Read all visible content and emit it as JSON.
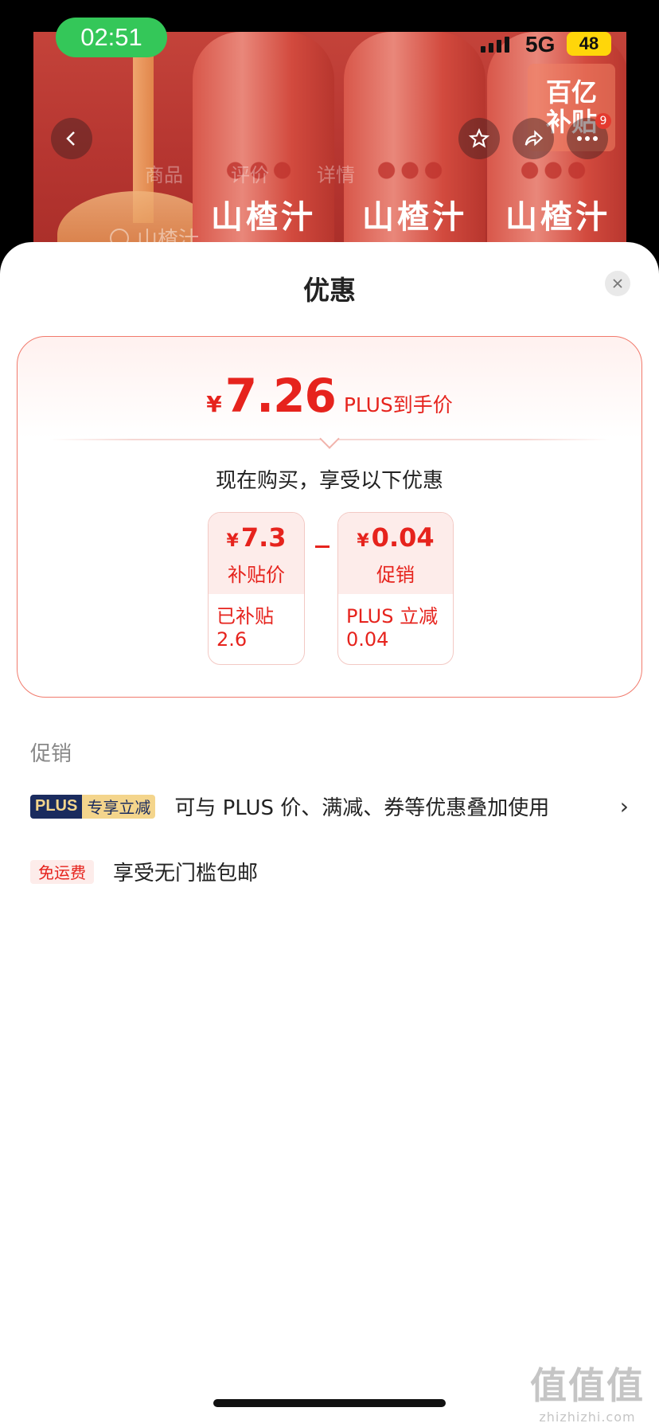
{
  "status_bar": {
    "time": "02:51",
    "network": "5G",
    "battery": "48",
    "colors": {
      "time_pill": "#34c759",
      "battery": "#ffd60a"
    }
  },
  "background_page": {
    "bottle_label": "山楂汁",
    "subsidy_badge": [
      "百亿",
      "补贴"
    ],
    "more_badge_count": "9",
    "tabs": [
      "商品",
      "评价",
      "详情"
    ],
    "search_text": "山楂汁",
    "icons": [
      "back-icon",
      "star-icon",
      "share-icon",
      "more-icon"
    ]
  },
  "sheet": {
    "title": "优惠",
    "close_icon": "close-icon"
  },
  "price_card": {
    "currency": "¥",
    "final_price": "7.26",
    "final_label": "PLUS到手价",
    "intro": "现在购买，享受以下优惠",
    "left": {
      "currency": "¥",
      "amount": "7.3",
      "label": "补贴价",
      "detail": "已补贴\n2.6"
    },
    "right": {
      "currency": "¥",
      "amount": "0.04",
      "label": "促销",
      "detail": "PLUS 立减\n0.04"
    },
    "accent_color": "#e6231d"
  },
  "promotions": {
    "section_label": "促销",
    "items": [
      {
        "tag_main": "PLUS",
        "tag_sub": "专享立减",
        "text": "可与 PLUS 价、满减、券等优惠叠加使用",
        "chevron": "›"
      },
      {
        "tag": "免运费",
        "text": "享受无门槛包邮"
      }
    ]
  },
  "watermark": {
    "main": "值值值",
    "sub": "zhizhizhi.com"
  }
}
